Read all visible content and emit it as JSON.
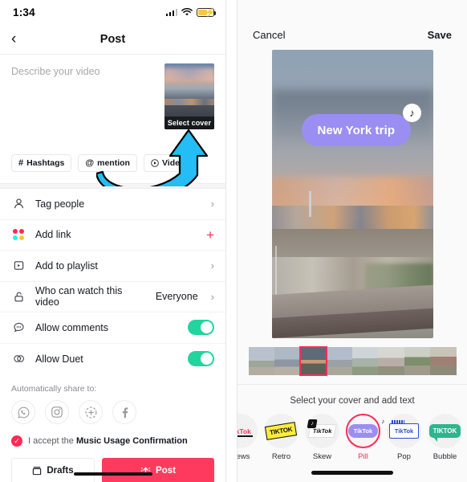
{
  "left_phone": {
    "status_bar": {
      "time": "1:34",
      "signal_icon": "cellular-signal-icon",
      "wifi_icon": "wifi-icon",
      "battery_icon": "battery-charging-icon"
    },
    "nav": {
      "back_icon": "back-chevron-icon",
      "title": "Post"
    },
    "compose": {
      "placeholder": "Describe your video",
      "cover_label": "Select cover"
    },
    "chips": [
      {
        "icon": "hashtag-icon",
        "glyph": "#",
        "label": "Hashtags"
      },
      {
        "icon": "at-mention-icon",
        "glyph": "@",
        "label": "mention"
      },
      {
        "icon": "videos-play-icon",
        "glyph": "ⓘ",
        "label": "Videos"
      }
    ],
    "rows": [
      {
        "icon": "person-icon",
        "label": "Tag people",
        "value": "",
        "accessory": "chevron"
      },
      {
        "icon": "add-link-dots-icon",
        "label": "Add link",
        "value": "",
        "accessory": "plus"
      },
      {
        "icon": "playlist-icon",
        "label": "Add to playlist",
        "value": "",
        "accessory": "chevron"
      },
      {
        "icon": "lock-open-icon",
        "label": "Who can watch this video",
        "value": "Everyone",
        "accessory": "chevron"
      },
      {
        "icon": "comment-icon",
        "label": "Allow comments",
        "value": "on",
        "accessory": "toggle"
      },
      {
        "icon": "duet-icon",
        "label": "Allow Duet",
        "value": "on",
        "accessory": "toggle"
      }
    ],
    "share": {
      "label": "Automatically share to:",
      "icons": [
        {
          "icon": "whatsapp-icon",
          "glyph": "✆"
        },
        {
          "icon": "instagram-icon",
          "glyph": "▢"
        },
        {
          "icon": "instagram-story-icon",
          "glyph": "⊕"
        },
        {
          "icon": "facebook-icon",
          "glyph": "f"
        }
      ]
    },
    "accept": {
      "check_icon": "check-circle-icon",
      "prefix": "I accept the ",
      "link": "Music Usage Confirmation"
    },
    "buttons": {
      "drafts": {
        "icon": "drafts-box-icon",
        "label": "Drafts"
      },
      "post": {
        "icon": "post-sparkle-icon",
        "label": "Post"
      }
    },
    "annotation": {
      "arrow_icon": "curved-up-arrow-annotation",
      "color": "#25BDF5"
    }
  },
  "right_phone": {
    "topbar": {
      "cancel": "Cancel",
      "save": "Save"
    },
    "video": {
      "overlay_text": "New York trip",
      "overlay_pill_color": "#9B8EF2",
      "tiktok_badge_icon": "tiktok-note-icon"
    },
    "filmstrip": {
      "frame_count": 8,
      "selected_index": 2,
      "selected_border_color": "#FE2C55"
    },
    "hint": "Select your cover and add text",
    "cover_styles": [
      {
        "name": "News",
        "badge": "news",
        "active": false
      },
      {
        "name": "Retro",
        "badge": "retro",
        "active": false
      },
      {
        "name": "Skew",
        "badge": "skew",
        "active": false
      },
      {
        "name": "Pill",
        "badge": "pill",
        "active": true
      },
      {
        "name": "Pop",
        "badge": "pop",
        "active": false
      },
      {
        "name": "Bubble",
        "badge": "bubble",
        "active": false
      }
    ],
    "style_labels": {
      "tiktok_wordmark": "TikTok",
      "tiktok_caps": "TIKTOK"
    }
  },
  "theme": {
    "accent_red": "#FE2C55",
    "toggle_green": "#20D5A0",
    "arrow_cyan": "#25BDF5",
    "pill_purple": "#9B8EF2"
  }
}
